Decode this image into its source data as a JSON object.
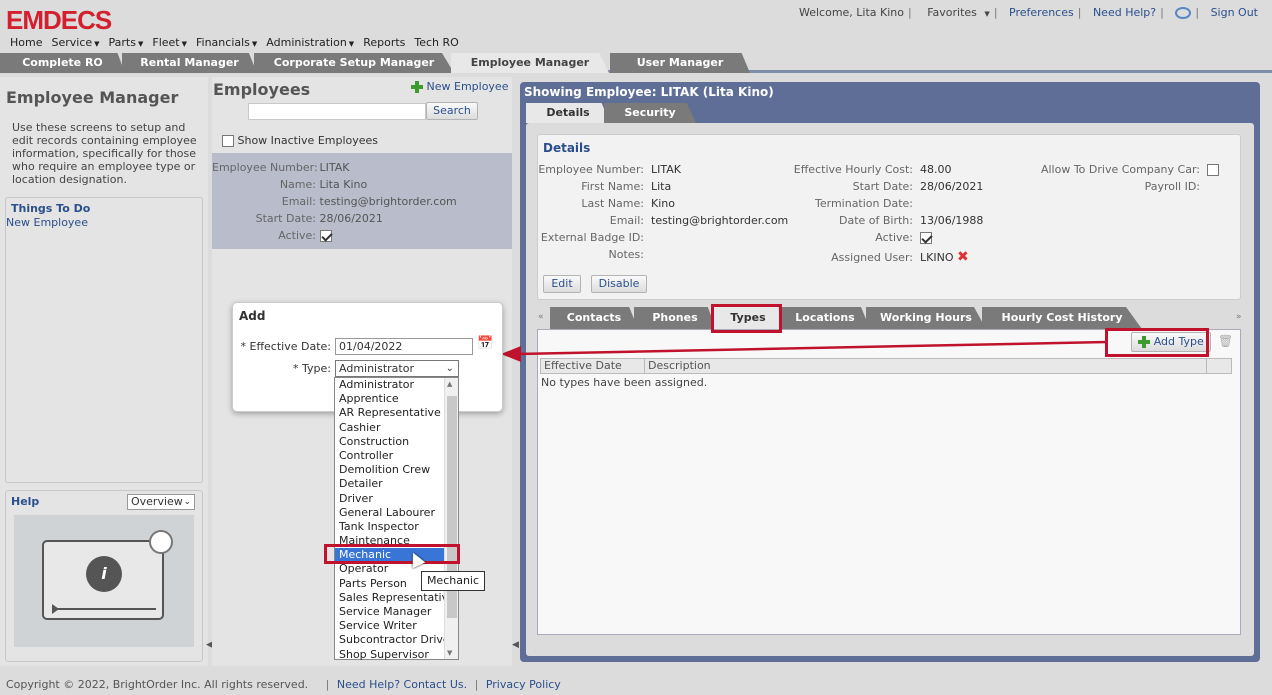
{
  "app": {
    "logo": "EMDECS"
  },
  "topbar": {
    "welcome": "Welcome, Lita Kino",
    "favorites": "Favorites",
    "preferences": "Preferences",
    "need_help": "Need Help?",
    "sign_out": "Sign Out"
  },
  "menu": [
    {
      "label": "Home",
      "dropdown": false
    },
    {
      "label": "Service",
      "dropdown": true
    },
    {
      "label": "Parts",
      "dropdown": true
    },
    {
      "label": "Fleet",
      "dropdown": true
    },
    {
      "label": "Financials",
      "dropdown": true
    },
    {
      "label": "Administration",
      "dropdown": true
    },
    {
      "label": "Reports",
      "dropdown": false
    },
    {
      "label": "Tech RO",
      "dropdown": false
    }
  ],
  "app_tabs": [
    "Complete RO",
    "Rental Manager",
    "Corporate Setup Manager",
    "Employee Manager",
    "User Manager"
  ],
  "left": {
    "title": "Employee Manager",
    "description": "Use these screens to setup and edit records containing employee information, specifically for those who require an employee type or location designation.",
    "todo_title": "Things To Do",
    "todo_link": "New Employee",
    "help_title": "Help",
    "help_select": "Overview"
  },
  "mid": {
    "title": "Employees",
    "new_employee": "New Employee",
    "search_btn": "Search",
    "inactive_label": "Show Inactive Employees",
    "card": {
      "number_label": "Employee Number:",
      "number": "LITAK",
      "name_label": "Name:",
      "name": "Lita Kino",
      "email_label": "Email:",
      "email": "testing@brightorder.com",
      "start_label": "Start Date:",
      "start": "28/06/2021",
      "active_label": "Active:"
    }
  },
  "dialog": {
    "title": "Add",
    "date_label": "* Effective Date:",
    "date_value": "01/04/2022",
    "type_label": "* Type:",
    "type_value": "Administrator",
    "options": [
      "Administrator",
      "Apprentice",
      "AR Representative",
      "Cashier",
      "Construction",
      "Controller",
      "Demolition Crew",
      "Detailer",
      "Driver",
      "General Labourer",
      "Tank Inspector",
      "Maintenance",
      "Mechanic",
      "Operator",
      "Parts Person",
      "Sales Representative",
      "Service Manager",
      "Service Writer",
      "Subcontractor Driver",
      "Shop Supervisor"
    ],
    "selected": "Mechanic",
    "tooltip": "Mechanic"
  },
  "right": {
    "title": "Showing Employee: LITAK (Lita Kino)",
    "tabs": [
      "Details",
      "Security"
    ],
    "details_title": "Details",
    "col1": [
      {
        "label": "Employee Number:",
        "value": "LITAK"
      },
      {
        "label": "First Name:",
        "value": "Lita"
      },
      {
        "label": "Last Name:",
        "value": "Kino"
      },
      {
        "label": "Email:",
        "value": "testing@brightorder.com"
      },
      {
        "label": "External Badge ID:",
        "value": ""
      },
      {
        "label": "Notes:",
        "value": ""
      }
    ],
    "col2": [
      {
        "label": "Effective Hourly Cost:",
        "value": "48.00"
      },
      {
        "label": "Start Date:",
        "value": "28/06/2021"
      },
      {
        "label": "Termination Date:",
        "value": ""
      },
      {
        "label": "Date of Birth:",
        "value": "13/06/1988"
      },
      {
        "label": "Active:",
        "value": ""
      },
      {
        "label": "Assigned User:",
        "value": "LKINO"
      }
    ],
    "col3": [
      {
        "label": "Allow To Drive Company Car:",
        "value": ""
      },
      {
        "label": "Payroll ID:",
        "value": ""
      }
    ],
    "edit_btn": "Edit",
    "disable_btn": "Disable",
    "subtabs": [
      "Contacts",
      "Phones",
      "Types",
      "Locations",
      "Working Hours",
      "Hourly Cost History"
    ],
    "add_type": "Add Type",
    "grid_headers": [
      "Effective Date",
      "Description"
    ],
    "empty_msg": "No types have been assigned."
  },
  "footer": {
    "copyright": "Copyright © 2022, BrightOrder Inc. All rights reserved.",
    "help_link": "Need Help? Contact Us.",
    "privacy": "Privacy Policy"
  }
}
